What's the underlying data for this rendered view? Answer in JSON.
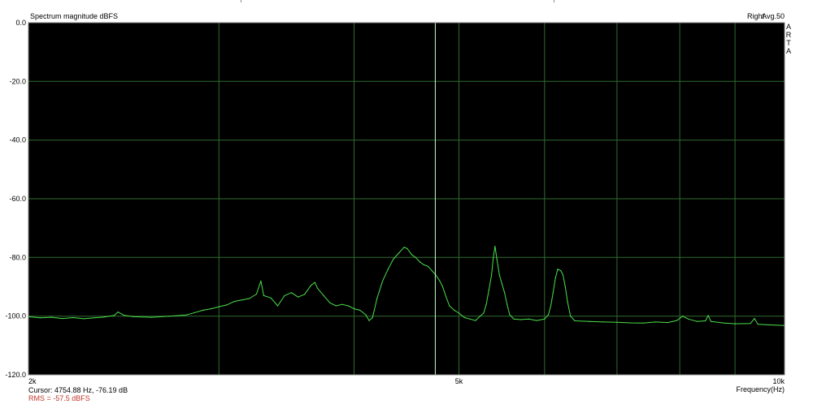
{
  "chart_data": {
    "type": "line",
    "title": "Spectrum magnitude dBFS",
    "channel": "Right",
    "averaging": "Avg.50",
    "brand": [
      "A",
      "R",
      "T",
      "A"
    ],
    "xlabel": "Frequency(Hz)",
    "ylabel": "",
    "x_scale": "log",
    "xlim": [
      2000,
      10000
    ],
    "ylim": [
      -120,
      0
    ],
    "x_tick_labels": [
      {
        "value": 2000,
        "label": "2k"
      },
      {
        "value": 5000,
        "label": "5k"
      },
      {
        "value": 10000,
        "label": "10k"
      }
    ],
    "y_tick_labels": [
      {
        "value": 0,
        "label": "0.0"
      },
      {
        "value": -20,
        "label": "-20.0"
      },
      {
        "value": -40,
        "label": "-40.0"
      },
      {
        "value": -60,
        "label": "-60.0"
      },
      {
        "value": -80,
        "label": "-80.0"
      },
      {
        "value": -100,
        "label": "-100.0"
      },
      {
        "value": -120,
        "label": "-120.0"
      }
    ],
    "x_gridlines": [
      3000,
      4000,
      5000,
      6000,
      7000,
      8000,
      9000
    ],
    "y_gridlines": [
      -20,
      -40,
      -60,
      -80,
      -100
    ],
    "grid": true,
    "background_color": "#000000",
    "grid_color": "#2f6b2f",
    "line_color": "#4be04b",
    "cursor_line_color": "#c8ffc8",
    "cursor": {
      "frequency_hz": 4754.88,
      "level_db": -76.19
    },
    "readouts": {
      "cursor": "Cursor: 4754.88 Hz, -76.19 dB",
      "rms": "RMS =  -57.5 dBFS"
    },
    "series": [
      {
        "values": [
          [
            2000,
            -100.2
          ],
          [
            2050,
            -100.6
          ],
          [
            2100,
            -100.4
          ],
          [
            2150,
            -100.8
          ],
          [
            2200,
            -100.5
          ],
          [
            2250,
            -100.9
          ],
          [
            2300,
            -100.6
          ],
          [
            2350,
            -100.3
          ],
          [
            2400,
            -99.8
          ],
          [
            2420,
            -98.6
          ],
          [
            2450,
            -99.7
          ],
          [
            2500,
            -100.2
          ],
          [
            2600,
            -100.4
          ],
          [
            2700,
            -100.0
          ],
          [
            2800,
            -99.6
          ],
          [
            2850,
            -98.8
          ],
          [
            2900,
            -98.0
          ],
          [
            2950,
            -97.5
          ],
          [
            3000,
            -96.8
          ],
          [
            3050,
            -96.2
          ],
          [
            3100,
            -95.0
          ],
          [
            3150,
            -94.5
          ],
          [
            3200,
            -94.0
          ],
          [
            3250,
            -92.5
          ],
          [
            3280,
            -88.0
          ],
          [
            3300,
            -93.0
          ],
          [
            3350,
            -93.8
          ],
          [
            3400,
            -96.5
          ],
          [
            3450,
            -93.0
          ],
          [
            3500,
            -92.0
          ],
          [
            3550,
            -93.5
          ],
          [
            3600,
            -92.6
          ],
          [
            3650,
            -89.5
          ],
          [
            3680,
            -88.5
          ],
          [
            3700,
            -90.5
          ],
          [
            3750,
            -93.0
          ],
          [
            3800,
            -95.5
          ],
          [
            3850,
            -96.5
          ],
          [
            3900,
            -96.0
          ],
          [
            3950,
            -96.5
          ],
          [
            4000,
            -97.5
          ],
          [
            4050,
            -98.0
          ],
          [
            4100,
            -99.5
          ],
          [
            4130,
            -101.5
          ],
          [
            4160,
            -100.5
          ],
          [
            4200,
            -94.0
          ],
          [
            4250,
            -88.0
          ],
          [
            4300,
            -84.0
          ],
          [
            4350,
            -80.5
          ],
          [
            4400,
            -78.5
          ],
          [
            4450,
            -76.5
          ],
          [
            4480,
            -77.0
          ],
          [
            4520,
            -79.0
          ],
          [
            4560,
            -80.0
          ],
          [
            4600,
            -81.5
          ],
          [
            4640,
            -82.5
          ],
          [
            4680,
            -83.0
          ],
          [
            4720,
            -84.5
          ],
          [
            4760,
            -86.0
          ],
          [
            4800,
            -88.0
          ],
          [
            4830,
            -90.0
          ],
          [
            4860,
            -93.0
          ],
          [
            4900,
            -96.5
          ],
          [
            4950,
            -98.0
          ],
          [
            5000,
            -99.0
          ],
          [
            5060,
            -100.5
          ],
          [
            5120,
            -101.0
          ],
          [
            5180,
            -101.5
          ],
          [
            5230,
            -100.0
          ],
          [
            5270,
            -99.0
          ],
          [
            5300,
            -96.0
          ],
          [
            5330,
            -91.0
          ],
          [
            5360,
            -86.0
          ],
          [
            5380,
            -80.0
          ],
          [
            5400,
            -76.2
          ],
          [
            5420,
            -80.5
          ],
          [
            5450,
            -86.0
          ],
          [
            5480,
            -89.0
          ],
          [
            5510,
            -92.0
          ],
          [
            5540,
            -96.0
          ],
          [
            5570,
            -99.5
          ],
          [
            5620,
            -101.0
          ],
          [
            5700,
            -101.2
          ],
          [
            5800,
            -101.0
          ],
          [
            5900,
            -101.5
          ],
          [
            6000,
            -101.0
          ],
          [
            6050,
            -99.5
          ],
          [
            6080,
            -96.5
          ],
          [
            6110,
            -92.0
          ],
          [
            6140,
            -87.0
          ],
          [
            6170,
            -84.0
          ],
          [
            6210,
            -84.5
          ],
          [
            6240,
            -86.0
          ],
          [
            6270,
            -90.0
          ],
          [
            6300,
            -95.0
          ],
          [
            6340,
            -100.0
          ],
          [
            6400,
            -101.6
          ],
          [
            6600,
            -101.8
          ],
          [
            6800,
            -102.0
          ],
          [
            7000,
            -102.1
          ],
          [
            7200,
            -102.3
          ],
          [
            7400,
            -102.4
          ],
          [
            7600,
            -102.0
          ],
          [
            7800,
            -102.2
          ],
          [
            7950,
            -101.5
          ],
          [
            8050,
            -100.0
          ],
          [
            8150,
            -101.0
          ],
          [
            8300,
            -101.8
          ],
          [
            8450,
            -101.6
          ],
          [
            8500,
            -99.8
          ],
          [
            8550,
            -101.8
          ],
          [
            8800,
            -102.4
          ],
          [
            9000,
            -102.6
          ],
          [
            9300,
            -102.5
          ],
          [
            9380,
            -100.8
          ],
          [
            9450,
            -102.8
          ],
          [
            9700,
            -103.0
          ],
          [
            10000,
            -103.2
          ]
        ]
      }
    ]
  }
}
